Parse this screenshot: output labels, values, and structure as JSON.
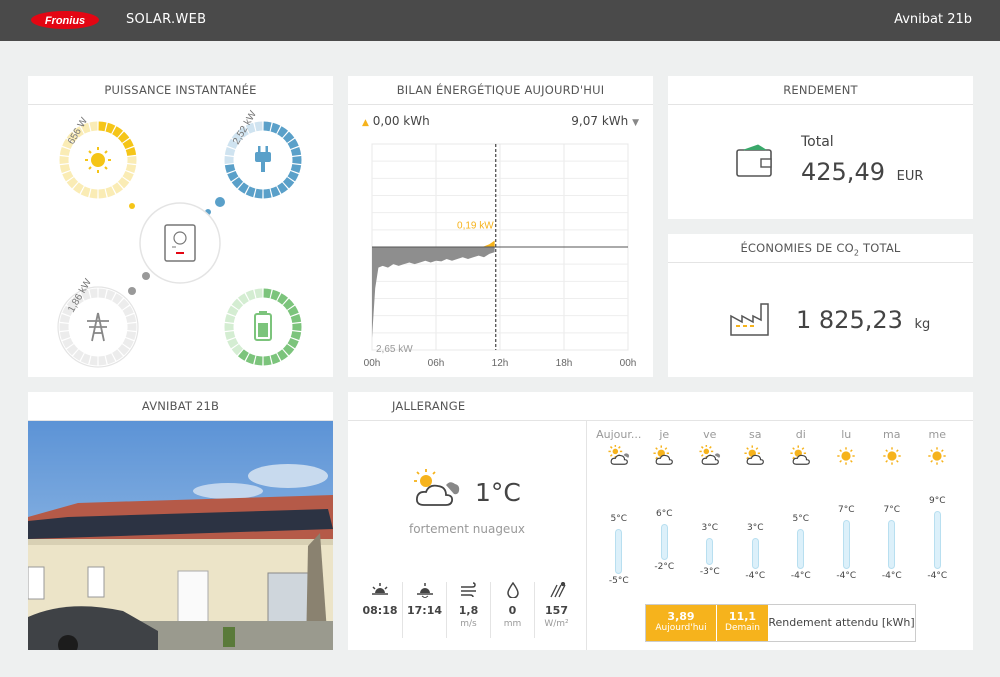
{
  "header": {
    "app_name": "SOLAR.WEB",
    "site_name": "Avnibat 21b",
    "logo_text": "Fronius"
  },
  "power_flow": {
    "title": "PUISSANCE INSTANTANÉE",
    "pv": {
      "label": "656 W",
      "fraction": 0.22
    },
    "load": {
      "label": "2,52 kW",
      "fraction": 0.7
    },
    "grid": {
      "label": "1,86 kW",
      "fraction": 0.0
    },
    "battery": {
      "fraction": 0.6
    }
  },
  "energy_balance": {
    "title": "BILAN ÉNERGÉTIQUE AUJOURD'HUI",
    "produced": "0,00 kWh",
    "consumed": "9,07 kWh",
    "chart_data": {
      "type": "area",
      "x_ticks": [
        "00h",
        "06h",
        "12h",
        "18h",
        "00h"
      ],
      "annotations": {
        "peak_production": "0,19 kW",
        "peak_consumption": "2,65 kW"
      },
      "x": [
        0,
        0.3,
        0.6,
        1,
        1.5,
        2,
        2.5,
        3,
        3.5,
        4,
        4.5,
        5,
        5.5,
        6,
        6.5,
        7,
        7.5,
        8,
        8.5,
        9,
        9.5,
        10,
        10.5,
        11,
        11.5
      ],
      "production": [
        0,
        0,
        0,
        0,
        0,
        0,
        0,
        0,
        0,
        0,
        0,
        0,
        0,
        0,
        0,
        0,
        0,
        0,
        0,
        0,
        0,
        0,
        0.02,
        0.08,
        0.19
      ],
      "consumption": [
        -2.65,
        -1.2,
        -0.6,
        -0.55,
        -0.6,
        -0.5,
        -0.55,
        -0.5,
        -0.45,
        -0.5,
        -0.45,
        -0.4,
        -0.45,
        -0.4,
        -0.42,
        -0.35,
        -0.4,
        -0.35,
        -0.3,
        -0.35,
        -0.3,
        -0.25,
        -0.3,
        -0.2,
        -0.15
      ],
      "xlim": [
        0,
        24
      ],
      "ylim": [
        -3,
        3
      ],
      "current_time": 11.6
    }
  },
  "yield": {
    "title": "RENDEMENT",
    "label": "Total",
    "value": "425,49",
    "unit": "EUR"
  },
  "co2": {
    "title_main": "ÉCONOMIES DE CO",
    "title_sub": "2",
    "title_end": " TOTAL",
    "value": "1 825,23",
    "unit": "kg"
  },
  "photo": {
    "title": "AVNIBAT 21B"
  },
  "weather": {
    "title": "JALLERANGE",
    "current_temp": "1°C",
    "condition": "fortement nuageux",
    "details": [
      {
        "icon": "sunrise-icon",
        "value": "08:18",
        "unit": ""
      },
      {
        "icon": "sunset-icon",
        "value": "17:14",
        "unit": ""
      },
      {
        "icon": "wind-icon",
        "value": "1,8",
        "unit": "m/s"
      },
      {
        "icon": "rain-icon",
        "value": "0",
        "unit": "mm"
      },
      {
        "icon": "irradiance-icon",
        "value": "157",
        "unit": "W/m²"
      }
    ],
    "forecast": [
      {
        "day": "Aujour...",
        "icon": "cloudy-icon",
        "high": "5°C",
        "low": "-5°C",
        "high_val": 5,
        "low_val": -5
      },
      {
        "day": "je",
        "icon": "partly-sunny-icon",
        "high": "6°C",
        "low": "-2°C",
        "high_val": 6,
        "low_val": -2
      },
      {
        "day": "ve",
        "icon": "cloudy-icon",
        "high": "3°C",
        "low": "-3°C",
        "high_val": 3,
        "low_val": -3
      },
      {
        "day": "sa",
        "icon": "partly-sunny-icon",
        "high": "3°C",
        "low": "-4°C",
        "high_val": 3,
        "low_val": -4
      },
      {
        "day": "di",
        "icon": "partly-sunny-icon",
        "high": "5°C",
        "low": "-4°C",
        "high_val": 5,
        "low_val": -4
      },
      {
        "day": "lu",
        "icon": "sunny-icon",
        "high": "7°C",
        "low": "-4°C",
        "high_val": 7,
        "low_val": -4
      },
      {
        "day": "ma",
        "icon": "sunny-icon",
        "high": "7°C",
        "low": "-4°C",
        "high_val": 7,
        "low_val": -4
      },
      {
        "day": "me",
        "icon": "sunny-icon",
        "high": "9°C",
        "low": "-4°C",
        "high_val": 9,
        "low_val": -4
      }
    ],
    "expected": {
      "today_value": "3,89",
      "today_label": "Aujourd'hui",
      "tomorrow_value": "11,1",
      "tomorrow_label": "Demain",
      "label": "Rendement attendu [kWh]"
    },
    "colors": {
      "accent": "#f6b31c",
      "bar": "#dcf0fa",
      "bar_border": "#b8dff0"
    }
  },
  "colors": {
    "pv": "#f5c518",
    "pv_light": "#faecb5",
    "load": "#5aa0c9",
    "load_light": "#cfe3f0",
    "battery": "#7cc47c",
    "battery_light": "#d4edd2",
    "grid": "#999999"
  }
}
